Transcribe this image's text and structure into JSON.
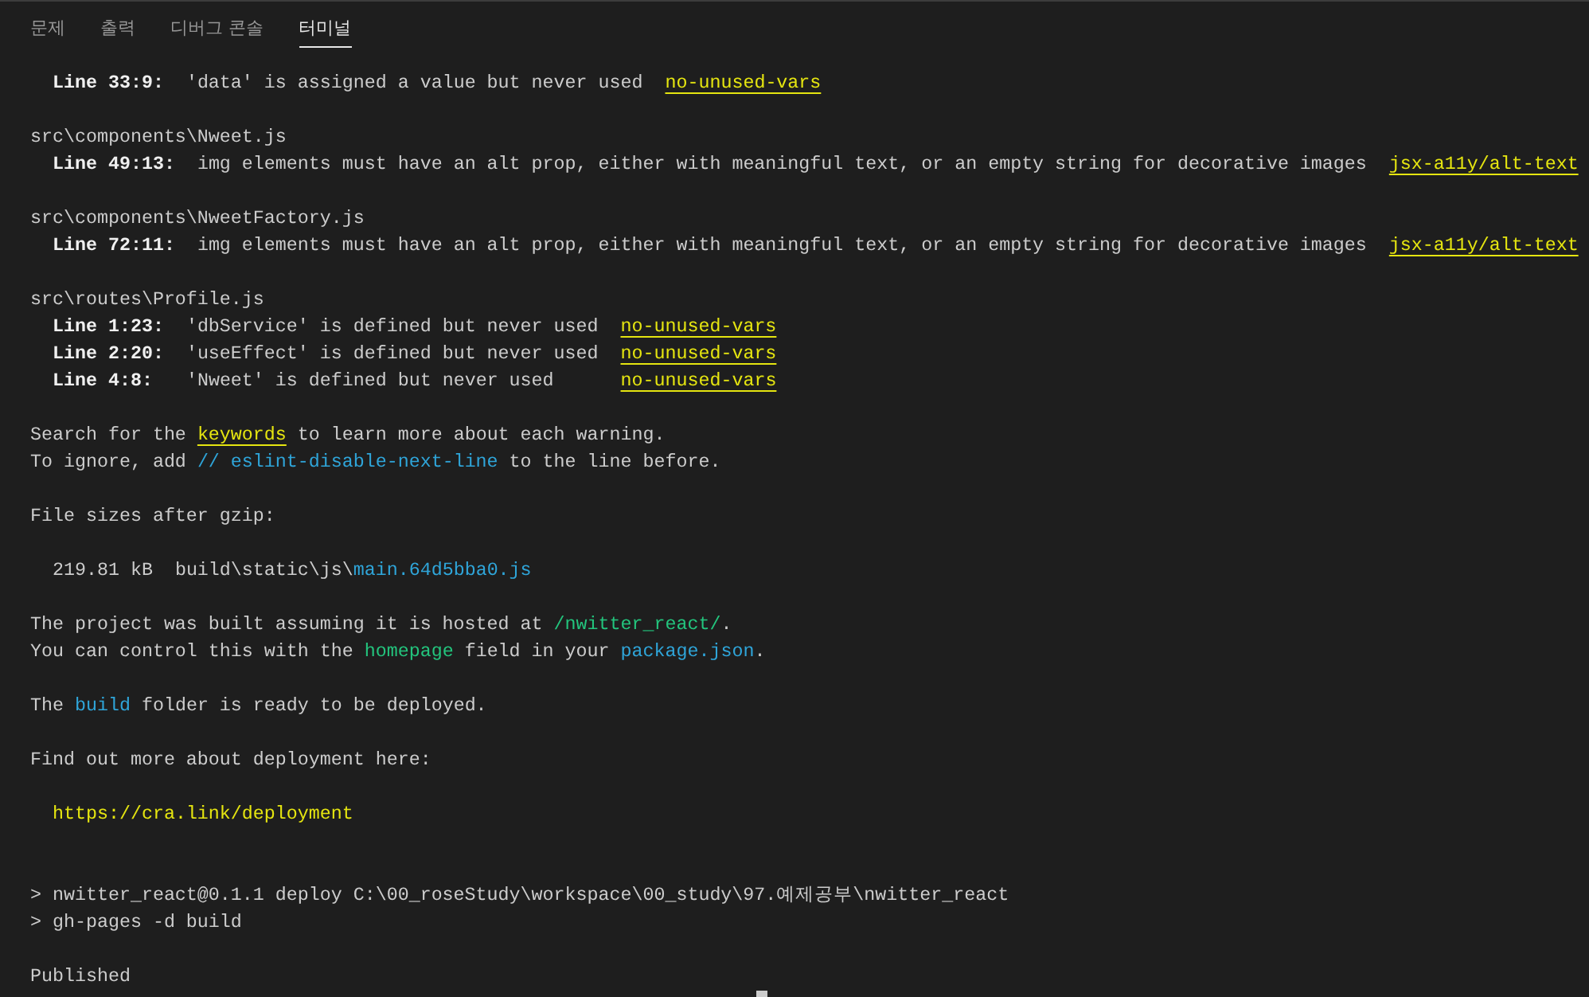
{
  "tabs": [
    {
      "label": "문제",
      "selected": false
    },
    {
      "label": "출력",
      "selected": false
    },
    {
      "label": "디버그 콘솔",
      "selected": false
    },
    {
      "label": "터미널",
      "selected": true
    }
  ],
  "terminal": {
    "lines": [
      {
        "kind": "text",
        "indented": true,
        "segments": [
          {
            "kind": "bold",
            "text": "Line 33:9:"
          },
          {
            "kind": "plain",
            "text": "  'data' is assigned a value but never used  "
          },
          {
            "kind": "rule",
            "text": "no-unused-vars"
          }
        ]
      },
      {
        "kind": "blank"
      },
      {
        "kind": "text",
        "indented": false,
        "segments": [
          {
            "kind": "plain",
            "text": "src\\components\\Nweet.js"
          }
        ]
      },
      {
        "kind": "text",
        "indented": true,
        "segments": [
          {
            "kind": "bold",
            "text": "Line 49:13:"
          },
          {
            "kind": "plain",
            "text": "  img elements must have an alt prop, either with meaningful text, or an empty string for decorative images  "
          },
          {
            "kind": "rule",
            "text": "jsx-a11y/alt-text"
          }
        ]
      },
      {
        "kind": "blank"
      },
      {
        "kind": "text",
        "indented": false,
        "segments": [
          {
            "kind": "plain",
            "text": "src\\components\\NweetFactory.js"
          }
        ]
      },
      {
        "kind": "text",
        "indented": true,
        "segments": [
          {
            "kind": "bold",
            "text": "Line 72:11:"
          },
          {
            "kind": "plain",
            "text": "  img elements must have an alt prop, either with meaningful text, or an empty string for decorative images  "
          },
          {
            "kind": "rule",
            "text": "jsx-a11y/alt-text"
          }
        ]
      },
      {
        "kind": "blank"
      },
      {
        "kind": "text",
        "indented": false,
        "segments": [
          {
            "kind": "plain",
            "text": "src\\routes\\Profile.js"
          }
        ]
      },
      {
        "kind": "text",
        "indented": true,
        "segments": [
          {
            "kind": "bold",
            "text": "Line 1:23:"
          },
          {
            "kind": "plain",
            "text": "  'dbService' is defined but never used  "
          },
          {
            "kind": "rule",
            "text": "no-unused-vars"
          }
        ]
      },
      {
        "kind": "text",
        "indented": true,
        "segments": [
          {
            "kind": "bold",
            "text": "Line 2:20:"
          },
          {
            "kind": "plain",
            "text": "  'useEffect' is defined but never used  "
          },
          {
            "kind": "rule",
            "text": "no-unused-vars"
          }
        ]
      },
      {
        "kind": "text",
        "indented": true,
        "segments": [
          {
            "kind": "bold",
            "text": "Line 4:8:"
          },
          {
            "kind": "plain",
            "text": "   'Nweet' is defined but never used      "
          },
          {
            "kind": "rule",
            "text": "no-unused-vars"
          }
        ]
      },
      {
        "kind": "blank"
      },
      {
        "kind": "text",
        "indented": false,
        "segments": [
          {
            "kind": "plain",
            "text": "Search for the "
          },
          {
            "kind": "rule",
            "text": "keywords"
          },
          {
            "kind": "plain",
            "text": " to learn more about each warning."
          }
        ]
      },
      {
        "kind": "text",
        "indented": false,
        "segments": [
          {
            "kind": "plain",
            "text": "To ignore, add "
          },
          {
            "kind": "blue",
            "text": "// eslint-disable-next-line"
          },
          {
            "kind": "plain",
            "text": " to the line before."
          }
        ]
      },
      {
        "kind": "blank"
      },
      {
        "kind": "text",
        "indented": false,
        "segments": [
          {
            "kind": "plain",
            "text": "File sizes after gzip:"
          }
        ]
      },
      {
        "kind": "blank"
      },
      {
        "kind": "text",
        "indented": true,
        "segments": [
          {
            "kind": "plain",
            "text": "219.81 kB  build\\static\\js\\"
          },
          {
            "kind": "blue",
            "text": "main.64d5bba0.js"
          }
        ]
      },
      {
        "kind": "blank"
      },
      {
        "kind": "text",
        "indented": false,
        "segments": [
          {
            "kind": "plain",
            "text": "The project was built assuming it is hosted at "
          },
          {
            "kind": "green",
            "text": "/nwitter_react/"
          },
          {
            "kind": "plain",
            "text": "."
          }
        ]
      },
      {
        "kind": "text",
        "indented": false,
        "segments": [
          {
            "kind": "plain",
            "text": "You can control this with the "
          },
          {
            "kind": "green",
            "text": "homepage"
          },
          {
            "kind": "plain",
            "text": " field in your "
          },
          {
            "kind": "blue",
            "text": "package.json"
          },
          {
            "kind": "plain",
            "text": "."
          }
        ]
      },
      {
        "kind": "blank"
      },
      {
        "kind": "text",
        "indented": false,
        "segments": [
          {
            "kind": "plain",
            "text": "The "
          },
          {
            "kind": "blue",
            "text": "build"
          },
          {
            "kind": "plain",
            "text": " folder is ready to be deployed."
          }
        ]
      },
      {
        "kind": "blank"
      },
      {
        "kind": "text",
        "indented": false,
        "segments": [
          {
            "kind": "plain",
            "text": "Find out more about deployment here:"
          }
        ]
      },
      {
        "kind": "blank"
      },
      {
        "kind": "text",
        "indented": true,
        "segments": [
          {
            "kind": "url",
            "text": "https://cra.link/deployment"
          }
        ]
      },
      {
        "kind": "blank"
      },
      {
        "kind": "blank"
      },
      {
        "kind": "text",
        "indented": false,
        "segments": [
          {
            "kind": "plain",
            "text": "> nwitter_react@0.1.1 deploy C:\\00_roseStudy\\workspace\\00_study\\97.예제공부\\nwitter_react"
          }
        ]
      },
      {
        "kind": "text",
        "indented": false,
        "segments": [
          {
            "kind": "plain",
            "text": "> gh-pages -d build"
          }
        ]
      },
      {
        "kind": "blank"
      },
      {
        "kind": "text",
        "indented": false,
        "segments": [
          {
            "kind": "plain",
            "text": "Published"
          }
        ]
      },
      {
        "kind": "cursor"
      }
    ]
  }
}
